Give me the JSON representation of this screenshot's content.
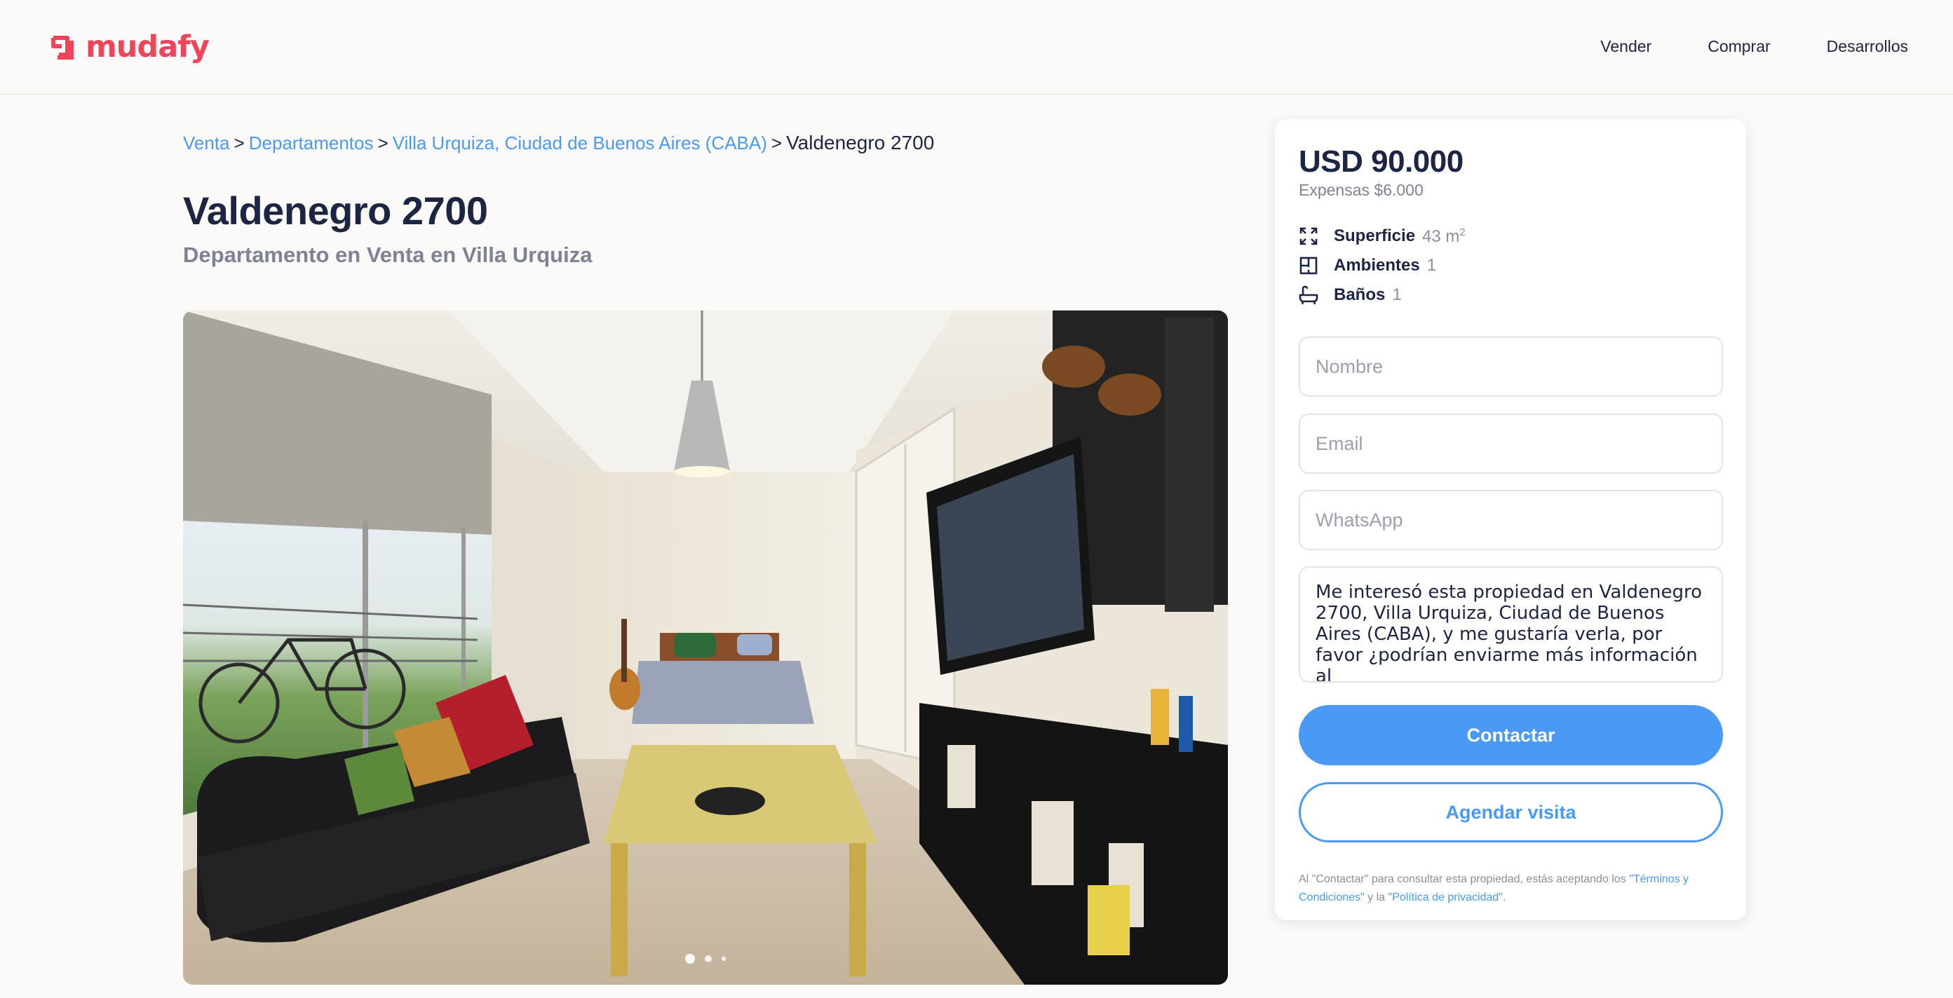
{
  "header": {
    "logo_text": "mudafy",
    "brand_color": "#f0445a",
    "nav": [
      {
        "label": "Vender"
      },
      {
        "label": "Comprar"
      },
      {
        "label": "Desarrollos"
      }
    ]
  },
  "breadcrumb": {
    "items": [
      "Venta",
      "Departamentos",
      "Villa Urquiza, Ciudad de Buenos Aires (CABA)"
    ],
    "separator": ">",
    "current": "Valdenegro 2700"
  },
  "listing": {
    "title": "Valdenegro 2700",
    "subtitle": "Departamento en Venta en Villa Urquiza",
    "gallery": {
      "current_index": 1,
      "dot_count": 3
    }
  },
  "card": {
    "price": "USD 90.000",
    "expensas": "Expensas $6.000",
    "features": [
      {
        "icon": "expand-icon",
        "label": "Superficie",
        "value": "43 m",
        "sup": "2"
      },
      {
        "icon": "floorplan-icon",
        "label": "Ambientes",
        "value": "1",
        "sup": ""
      },
      {
        "icon": "bathtub-icon",
        "label": "Baños",
        "value": "1",
        "sup": ""
      }
    ],
    "form": {
      "name_placeholder": "Nombre",
      "email_placeholder": "Email",
      "whatsapp_placeholder": "WhatsApp",
      "message_value": "Me interesó esta propiedad en Valdenegro 2700, Villa Urquiza, Ciudad de Buenos Aires (CABA), y me gustaría verla, por favor ¿podrían enviarme más información al"
    },
    "contact_button": "Contactar",
    "visit_button": "Agendar visita",
    "legal": {
      "prefix": "Al \"Contactar\" para consultar esta propiedad, estás aceptando los ",
      "terms_link": "\"Términos y Condiciones\"",
      "middle": " y la ",
      "privacy_link": "\"Política de privacidad\"",
      "suffix": "."
    },
    "accent_color": "#4a9af5"
  }
}
